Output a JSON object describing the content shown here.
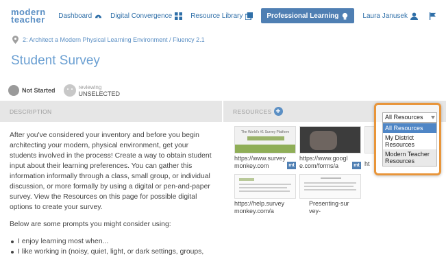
{
  "logo": {
    "line1": "modern",
    "line2": "teacher"
  },
  "nav": {
    "items": [
      {
        "label": "Dashboard",
        "icon": "dashboard-icon"
      },
      {
        "label": "Digital Convergence",
        "icon": "grid-icon"
      },
      {
        "label": "Resource Library",
        "icon": "library-icon"
      },
      {
        "label": "Professional Learning",
        "icon": "lightbulb-icon",
        "active": true
      },
      {
        "label": "Laura Janusek",
        "icon": "user-icon"
      }
    ],
    "flag_icon": "flag-icon"
  },
  "breadcrumb": "2: Architect a Modern Physical Learning Environment / Fluency 2.1",
  "page_title": "Student Survey",
  "status": {
    "label": "Not Started",
    "reviewing_small": "reviewing",
    "reviewing_value": "UNSELECTED"
  },
  "sections": {
    "description": "DESCRIPTION",
    "resources": "RESOURCES"
  },
  "description": {
    "p1": "After you've considered your inventory and before you begin architecting your modern, physical environment, get your students involved in the process! Create a way to obtain student input about their learning preferences. You can gather this information informally through a class, small group, or individual discussion, or more formally by using a digital or pen-and-paper survey. View the Resources on this page for possible digital options to create your survey.",
    "p2": "Below are some prompts you might consider using:",
    "bullets": [
      "I enjoy learning most when...",
      "I like working in (noisy, quiet, light, or dark settings, groups,"
    ]
  },
  "resources": [
    {
      "text": "https://www.surveymonkey.com",
      "badge": "mt",
      "thumb_title": "The World's #1 Survey Platform"
    },
    {
      "text": "https://www.google.com/forms/a",
      "badge": "mt"
    },
    {
      "text": "ht",
      "badge": ""
    },
    {
      "text": "https://help.surveymonkey.com/a",
      "badge": ""
    },
    {
      "text": "Presenting-survey-",
      "badge": ""
    }
  ],
  "dropdown": {
    "selected": "All Resources",
    "options": [
      "All Resources",
      "My District Resources",
      "Modern Teacher Resources"
    ]
  },
  "colors": {
    "accent": "#4f7fb3",
    "link": "#2f6fa8",
    "title": "#6a9fd2",
    "highlight_border": "#e8953a"
  }
}
